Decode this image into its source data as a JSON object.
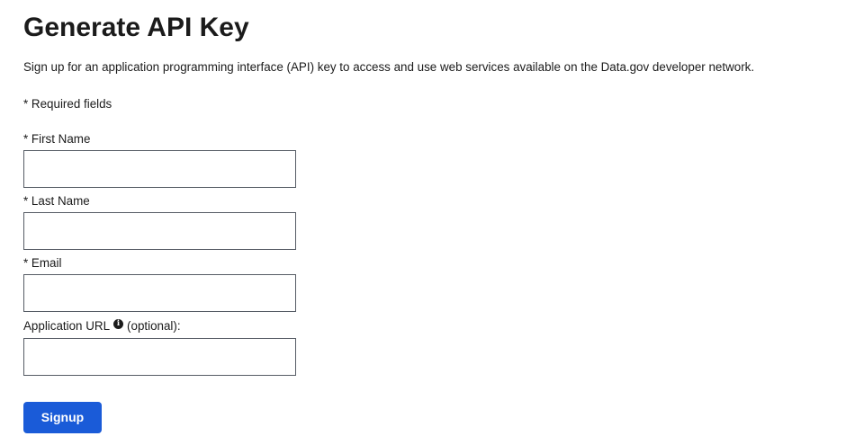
{
  "page": {
    "title": "Generate API Key",
    "intro": "Sign up for an application programming interface (API) key to access and use web services available on the Data.gov developer network.",
    "required_note": "* Required fields"
  },
  "form": {
    "first_name": {
      "label": "* First Name",
      "value": "",
      "placeholder": ""
    },
    "last_name": {
      "label": "* Last Name",
      "value": "",
      "placeholder": ""
    },
    "email": {
      "label": "* Email",
      "value": "",
      "placeholder": ""
    },
    "application_url": {
      "label": "Application URL",
      "info_icon": "info-icon",
      "suffix": "(optional):",
      "value": "",
      "placeholder": ""
    },
    "submit_label": "Signup"
  },
  "colors": {
    "button_background": "#1a5bd8",
    "button_text": "#ffffff",
    "text": "#1b1b1b",
    "input_border": "#565c65"
  }
}
